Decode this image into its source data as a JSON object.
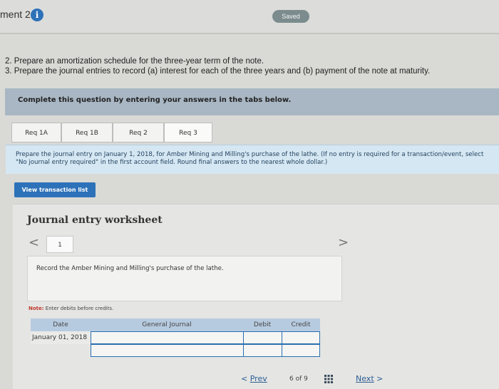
{
  "header": {
    "title": "ment 2",
    "info_icon": "i",
    "saved_badge": "Saved"
  },
  "instructions": [
    "2. Prepare an amortization schedule for the three-year term of the note.",
    "3. Prepare the journal entries to record (a) interest for each of the three years and (b) payment of the note at maturity."
  ],
  "complete_bar": "Complete this question by entering your answers in the tabs below.",
  "tabs": [
    {
      "label": "Req 1A"
    },
    {
      "label": "Req 1B"
    },
    {
      "label": "Req 2"
    },
    {
      "label": "Req 3"
    }
  ],
  "prompt": "Prepare the journal entry on January 1, 2018, for Amber Mining and Milling's purchase of the lathe. (If no entry is required for a transaction/event, select \"No journal entry required\" in the first account field. Round final answers to the nearest whole dollar.)",
  "view_button": "View transaction list",
  "worksheet": {
    "title": "Journal entry worksheet",
    "prev_symbol": "<",
    "next_symbol": ">",
    "page_number": "1",
    "record_text": "Record the Amber Mining and Milling's purchase of the lathe.",
    "note_label": "Note:",
    "note_text": "Enter debits before credits.",
    "table": {
      "headers": [
        "Date",
        "General Journal",
        "Debit",
        "Credit"
      ],
      "date_value": "January 01, 2018"
    }
  },
  "pager": {
    "prev_label": "Prev",
    "count": "6 of 9",
    "next_label": "Next"
  },
  "colors": {
    "accent": "#2d72b9",
    "complete_bar": "#a9b7c4",
    "table_header": "#b7cbe0",
    "prompt_bg": "#d5e7f2"
  }
}
